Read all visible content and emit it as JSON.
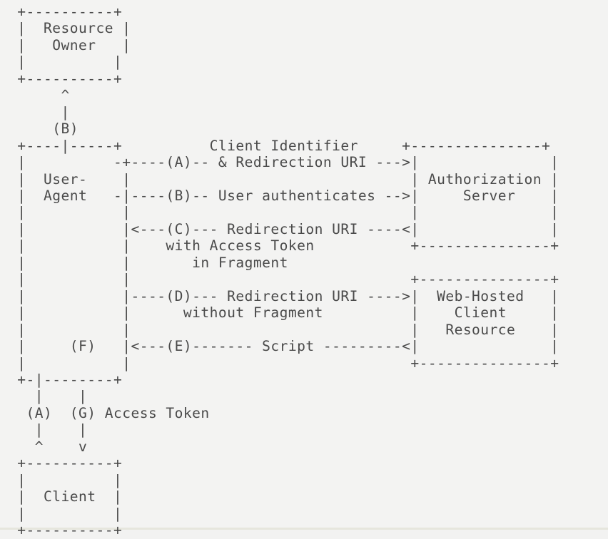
{
  "document": {
    "kind": "ascii-art-diagram",
    "title": "OAuth 2.0 Implicit Grant Flow",
    "background_color": "#f3f3f2",
    "text_color": "#4a4a4a"
  },
  "boxes": {
    "resource_owner": {
      "label_line_1": "Resource",
      "label_line_2": "Owner",
      "border_width_chars": 12
    },
    "user_agent": {
      "label_line_1": "User-",
      "label_line_2": "Agent",
      "border_width_chars": 12
    },
    "authorization_server": {
      "label_line_1": "Authorization",
      "label_line_2": "Server",
      "border_width_chars": 17
    },
    "web_hosted_client_resource": {
      "label_line_1": "Web-Hosted",
      "label_line_2": "Client",
      "label_line_3": "Resource",
      "border_width_chars": 17
    },
    "client": {
      "label_line_1": "Client",
      "border_width_chars": 12
    }
  },
  "flow_steps": [
    {
      "id": "A",
      "marker": "(A)",
      "text": "Client Identifier & Redirection URI",
      "direction": "user-agent-to-authorization-server"
    },
    {
      "id": "B",
      "marker": "(B)",
      "text": "User authenticates",
      "direction": "user-agent-to-authorization-server"
    },
    {
      "id": "C",
      "marker": "(C)",
      "text": "Redirection URI with Access Token in Fragment",
      "direction": "authorization-server-to-user-agent"
    },
    {
      "id": "D",
      "marker": "(D)",
      "text": "Redirection URI without Fragment",
      "direction": "user-agent-to-web-hosted-client-resource"
    },
    {
      "id": "E",
      "marker": "(E)",
      "text": "Script",
      "direction": "web-hosted-client-resource-to-user-agent"
    },
    {
      "id": "F",
      "marker": "(F)",
      "text": "",
      "direction": "user-agent-internal"
    },
    {
      "id": "G",
      "marker": "(G)",
      "text": "Access Token",
      "direction": "user-agent-to-client"
    }
  ],
  "labels": {
    "client_identifier": "Client Identifier",
    "redirection_uri_amp": "& Redirection URI",
    "user_authenticates": "User authenticates",
    "redirection_uri": "Redirection URI",
    "with_access_token": "with Access Token",
    "in_fragment": "in Fragment",
    "without_fragment": "without Fragment",
    "script": "Script",
    "access_token": "Access Token",
    "marker_a": "(A)",
    "marker_b": "(B)",
    "marker_c": "(C)",
    "marker_d": "(D)",
    "marker_e": "(E)",
    "marker_f": "(F)",
    "marker_g": "(G)"
  },
  "ascii": {
    "art": " +----------+\n |  Resource |\n |   Owner   |\n |          |\n +----------+\n      ^\n      |\n     (B)\n +----|-----+          Client Identifier     +---------------+\n |          -+----(A)-- & Redirection URI --->|               |\n |  User-    |                                | Authorization |\n |  Agent   -|----(B)-- User authenticates -->|     Server    |\n |           |                                |               |\n |           |<---(C)--- Redirection URI ----<|               |\n |           |    with Access Token           +---------------+\n |           |       in Fragment\n |           |                                +---------------+\n |           |----(D)--- Redirection URI ---->|  Web-Hosted   |\n |           |      without Fragment          |    Client     |\n |           |                                |   Resource    |\n |     (F)   |<---(E)------- Script ---------<|               |\n |           |                                +---------------+\n +-|--------+\n   |    |\n  (A)  (G) Access Token\n   |    |\n   ^    v\n +----------+\n |          |\n |  Client  |\n |          |\n +----------+"
  }
}
